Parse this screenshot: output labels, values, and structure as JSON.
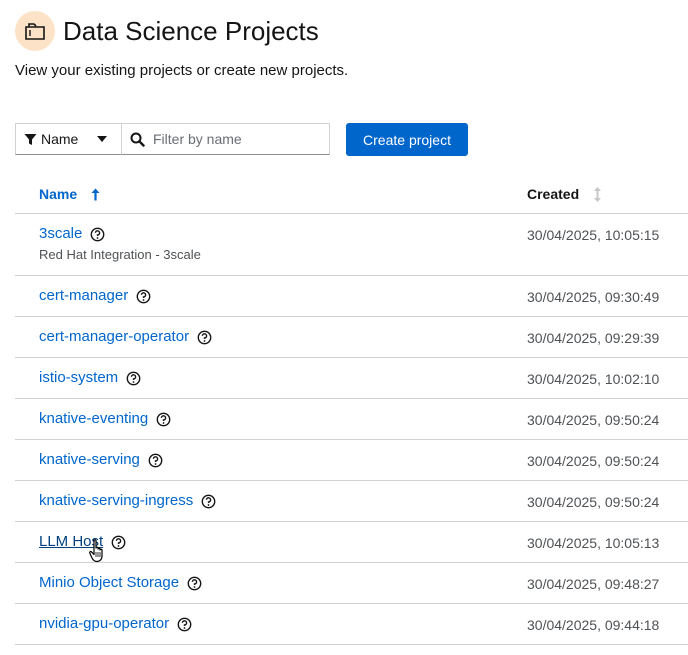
{
  "header": {
    "icon": "folder-icon",
    "title": "Data Science Projects",
    "description": "View your existing projects or create new projects."
  },
  "toolbar": {
    "filter_label": "Name",
    "search_placeholder": "Filter by name",
    "search_value": "",
    "create_label": "Create project",
    "accent_color": "#0066cc"
  },
  "table": {
    "columns": {
      "name": "Name",
      "created": "Created"
    },
    "rows": [
      {
        "name": "3scale",
        "subtitle": "Red Hat Integration - 3scale",
        "created": "30/04/2025, 10:05:15"
      },
      {
        "name": "cert-manager",
        "created": "30/04/2025, 09:30:49"
      },
      {
        "name": "cert-manager-operator",
        "created": "30/04/2025, 09:29:39"
      },
      {
        "name": "istio-system",
        "created": "30/04/2025, 10:02:10"
      },
      {
        "name": "knative-eventing",
        "created": "30/04/2025, 09:50:24"
      },
      {
        "name": "knative-serving",
        "created": "30/04/2025, 09:50:24"
      },
      {
        "name": "knative-serving-ingress",
        "created": "30/04/2025, 09:50:24"
      },
      {
        "name": "LLM Host",
        "created": "30/04/2025, 10:05:13"
      },
      {
        "name": "Minio Object Storage",
        "created": "30/04/2025, 09:48:27"
      },
      {
        "name": "nvidia-gpu-operator",
        "created": "30/04/2025, 09:44:18"
      }
    ]
  }
}
